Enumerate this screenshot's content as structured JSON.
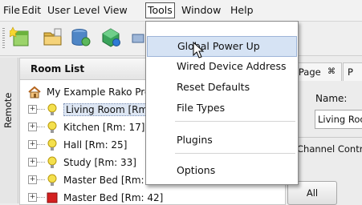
{
  "menubar": {
    "items": [
      "File",
      "Edit",
      "User Level",
      "View",
      "Tools",
      "Window",
      "Help"
    ],
    "active": "Tools"
  },
  "toolbar": {
    "icons": [
      "new-project-icon",
      "open-folder-icon",
      "database-icon",
      "add-device-icon",
      "network-icon"
    ]
  },
  "sidebar": {
    "tab_label": "Remote"
  },
  "room_list": {
    "title": "Room List",
    "root": "My Example Rako Pro",
    "rooms": [
      {
        "label": "Living Room  [Rm:",
        "icon": "bulb-icon",
        "selected": true
      },
      {
        "label": "Kitchen  [Rm: 17]",
        "icon": "bulb-icon",
        "selected": false
      },
      {
        "label": "Hall  [Rm: 25]",
        "icon": "bulb-icon",
        "selected": false
      },
      {
        "label": "Study  [Rm: 33]",
        "icon": "bulb-icon",
        "selected": false
      },
      {
        "label": "Master Bed [Rm:",
        "icon": "bulb-icon",
        "selected": false
      },
      {
        "label": "Master Bed [Rm: 42]",
        "icon": "red-square-icon",
        "selected": false
      }
    ]
  },
  "right_pane": {
    "tabs": [
      "rt Page",
      "P"
    ],
    "tab_close": "⌘",
    "name_label": "Name:",
    "name_value": "Living Roo",
    "channel_label": "Channel Contro",
    "all_button": "All"
  },
  "tools_menu": {
    "items": [
      {
        "label": "Global Power Up",
        "hover": true
      },
      {
        "label": "Wired Device Address",
        "hover": false
      },
      {
        "label": "Reset Defaults",
        "hover": false
      },
      {
        "label": "File Types",
        "hover": false
      },
      {
        "label": "Plugins",
        "hover": false
      },
      {
        "label": "Options",
        "hover": false
      }
    ]
  },
  "colors": {
    "accent_hover": "#d6e3f4",
    "bulb": "#f4e04d",
    "red_icon": "#d42020"
  }
}
